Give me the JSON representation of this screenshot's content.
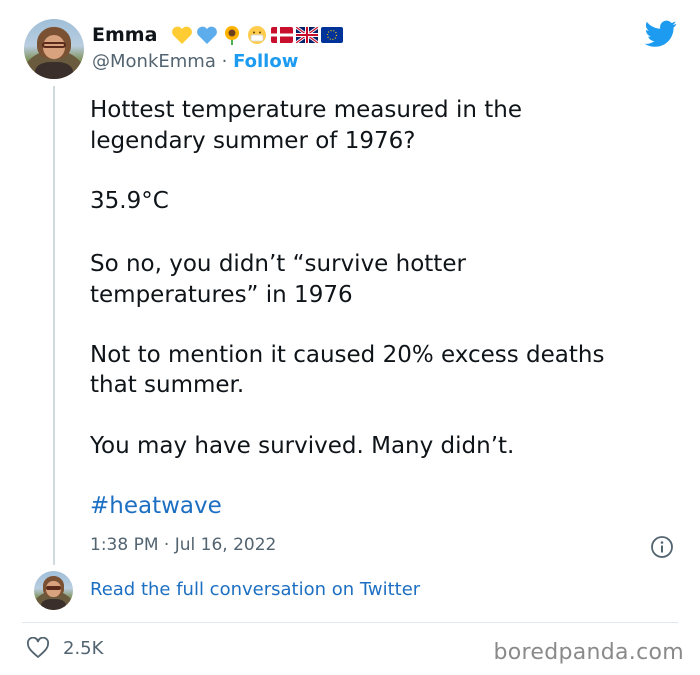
{
  "author": {
    "name": "Emma",
    "handle": "@MonkEmma",
    "separator": "·",
    "follow_label": "Follow",
    "badges": [
      "yellow-heart",
      "blue-heart",
      "sunflower",
      "face-with-mask",
      "denmark-flag",
      "uk-flag",
      "eu-flag"
    ]
  },
  "tweet": {
    "lines": [
      "Hottest temperature measured in the",
      "legendary summer of 1976?",
      "35.9°C",
      "So no, you didn’t “survive hotter",
      "temperatures” in 1976",
      "Not to mention it caused 20% excess deaths",
      "that summer.",
      "You may have survived. Many didn’t."
    ],
    "hashtag": "#heatwave",
    "time": "1:38 PM",
    "date": "Jul 16, 2022",
    "time_separator": "·"
  },
  "conversation": {
    "link_label": "Read the full conversation on Twitter"
  },
  "footer": {
    "likes": "2.5K",
    "watermark": "boredpanda.com"
  },
  "colors": {
    "twitter_blue": "#1d9bf0",
    "link_blue": "#1d6fc2",
    "muted_gray": "#536471",
    "thread_line": "#cfd9de"
  },
  "icons": [
    "twitter-bird-icon",
    "info-icon",
    "heart-icon"
  ]
}
